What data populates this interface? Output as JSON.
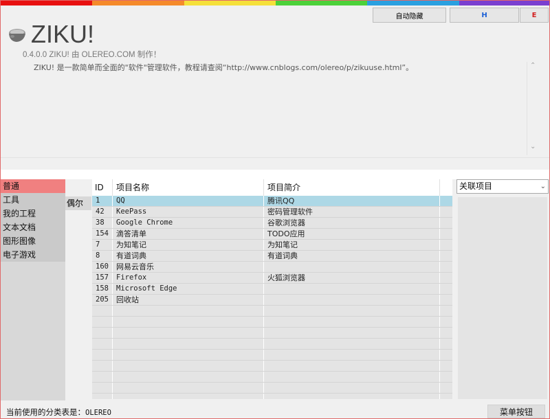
{
  "colors": {
    "rainbow": [
      "#e81010",
      "#f58a2a",
      "#f5e03a",
      "#4cd13a",
      "#2aa0e0",
      "#7a3fd0"
    ],
    "accent_category": "#f08080",
    "selected_row": "#add8e6"
  },
  "toolbar": {
    "auto_hide_label": "自动隐藏",
    "h_label": "H",
    "e_label": "E"
  },
  "header": {
    "logo_icon": "stone-bowl-icon",
    "app_title": "ZIKU!",
    "version_line": "0.4.0.0  ZIKU! 由 OLEREO.COM 制作！",
    "description": "ZIKU! 是一款简单而全面的\"软件\"管理软件，教程请查阅“http://www.cnblogs.com/olereo/p/zikuuse.html”。"
  },
  "categories": [
    {
      "label": "普通"
    },
    {
      "label": "工具"
    },
    {
      "label": "我的工程"
    },
    {
      "label": "文本文档"
    },
    {
      "label": "图形图像"
    },
    {
      "label": "电子游戏"
    }
  ],
  "extra_tab": "偶尔",
  "table": {
    "columns": [
      "ID",
      "项目名称",
      "项目简介"
    ],
    "rows": [
      {
        "id": "1",
        "name": "QQ",
        "desc": "腾讯QQ"
      },
      {
        "id": "42",
        "name": "KeePass",
        "desc": "密码管理软件"
      },
      {
        "id": "38",
        "name": "Google Chrome",
        "desc": "谷歌浏览器"
      },
      {
        "id": "154",
        "name": "滴答清单",
        "desc": "TODO应用"
      },
      {
        "id": "7",
        "name": "为知笔记",
        "desc": "为知笔记"
      },
      {
        "id": "8",
        "name": "有道词典",
        "desc": "有道词典"
      },
      {
        "id": "160",
        "name": "网易云音乐",
        "desc": ""
      },
      {
        "id": "157",
        "name": "Firefox",
        "desc": "火狐浏览器"
      },
      {
        "id": "158",
        "name": "Microsoft Edge",
        "desc": ""
      },
      {
        "id": "205",
        "name": "回收站",
        "desc": ""
      }
    ]
  },
  "related": {
    "select_value": "关联项目"
  },
  "status": {
    "prefix": "当前使用的分类表是：",
    "value": "OLEREO"
  },
  "menu_button_label": "菜单按钮"
}
